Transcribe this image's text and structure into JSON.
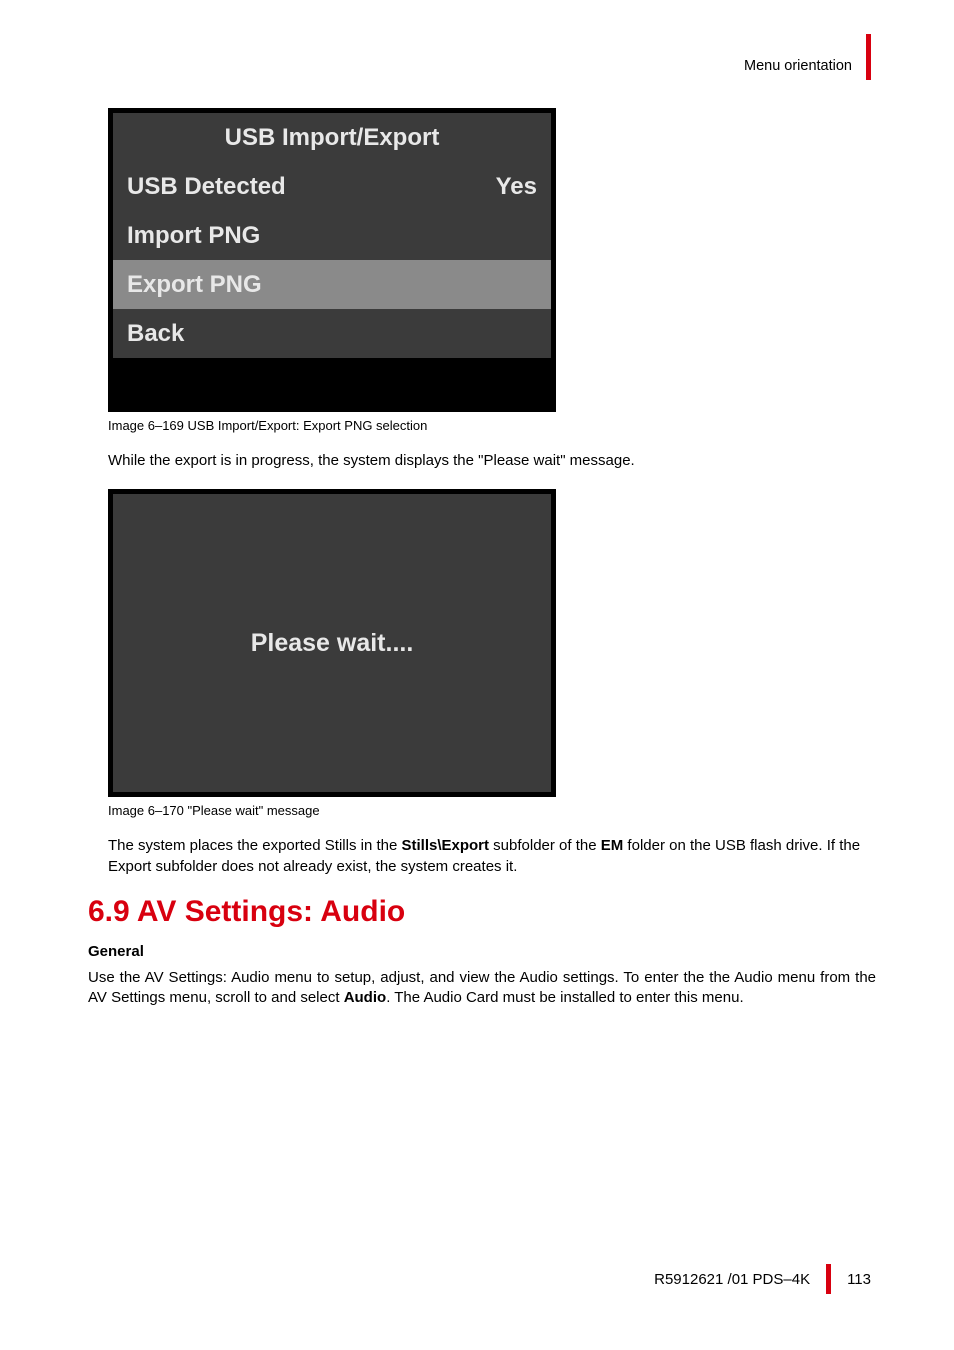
{
  "header": {
    "section": "Menu orientation"
  },
  "figure1": {
    "title": "USB Import/Export",
    "rows": [
      {
        "label": "USB Detected",
        "value": "Yes",
        "style": "dark"
      },
      {
        "label": "Import PNG",
        "value": "",
        "style": "dark"
      },
      {
        "label": "Export PNG",
        "value": "",
        "style": "selected"
      },
      {
        "label": "Back",
        "value": "",
        "style": "dark"
      }
    ],
    "caption": "Image 6–169  USB Import/Export: Export PNG selection"
  },
  "text1": "While the export is in progress, the system displays the \"Please wait\" message.",
  "figure2": {
    "message": "Please wait....",
    "caption": "Image 6–170  \"Please wait\" message"
  },
  "text2_parts": {
    "p1": "The system places the exported Stills in the ",
    "b1": "Stills\\Export",
    "p2": " subfolder of the ",
    "b2": "EM",
    "p3": " folder on the USB flash drive. If the Export subfolder does not already exist, the system creates it."
  },
  "section": {
    "heading": "6.9 AV Settings: Audio",
    "subheading": "General",
    "para_parts": {
      "p1": "Use the AV Settings: Audio menu to setup, adjust, and view the Audio settings. To enter the the Audio menu from the AV Settings menu, scroll to and select ",
      "b1": "Audio",
      "p2": ". The Audio Card must be installed to enter this menu."
    }
  },
  "footer": {
    "doc": "R5912621 /01 PDS–4K",
    "page": "113"
  }
}
